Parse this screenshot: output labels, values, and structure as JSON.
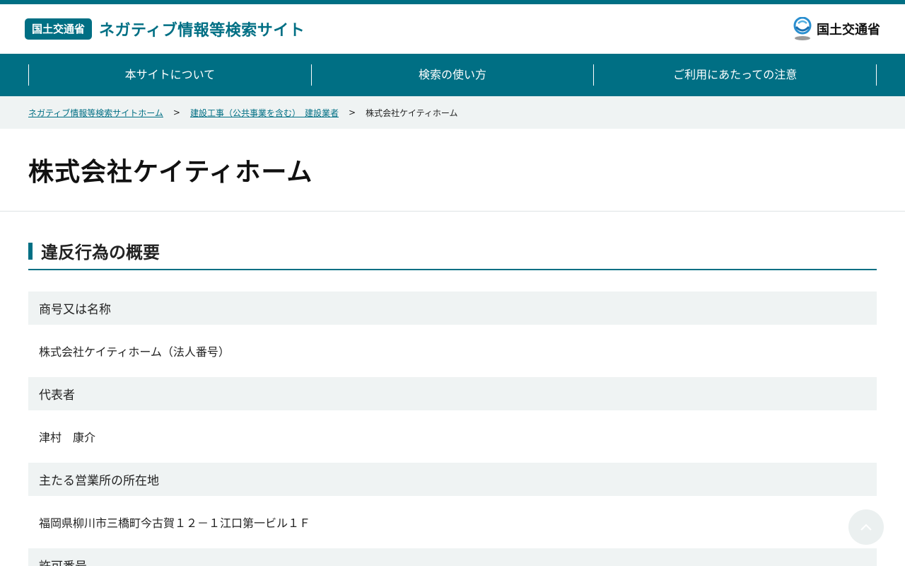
{
  "header": {
    "badge": "国土交通省",
    "site_title": "ネガティブ情報等検索サイト",
    "ministry_name": "国土交通省"
  },
  "nav": {
    "items": [
      "本サイトについて",
      "検索の使い方",
      "ご利用にあたっての注意"
    ]
  },
  "breadcrumb": {
    "home": "ネガティブ情報等検索サイトホーム",
    "category": "建設工事（公共事業を含む）　建設業者",
    "separator": ">",
    "current": "株式会社ケイティホーム"
  },
  "page": {
    "title": "株式会社ケイティホーム"
  },
  "section": {
    "title": "違反行為の概要"
  },
  "info": [
    {
      "label": "商号又は名称",
      "value": "株式会社ケイティホーム（法人番号）"
    },
    {
      "label": "代表者",
      "value": "津村　康介"
    },
    {
      "label": "主たる営業所の所在地",
      "value": "福岡県柳川市三橋町今古賀１２－１江口第一ビル１Ｆ"
    },
    {
      "label": "許可番号",
      "value": ""
    }
  ],
  "colors": {
    "brand": "#006f84",
    "label_bg": "#eff3f3"
  }
}
